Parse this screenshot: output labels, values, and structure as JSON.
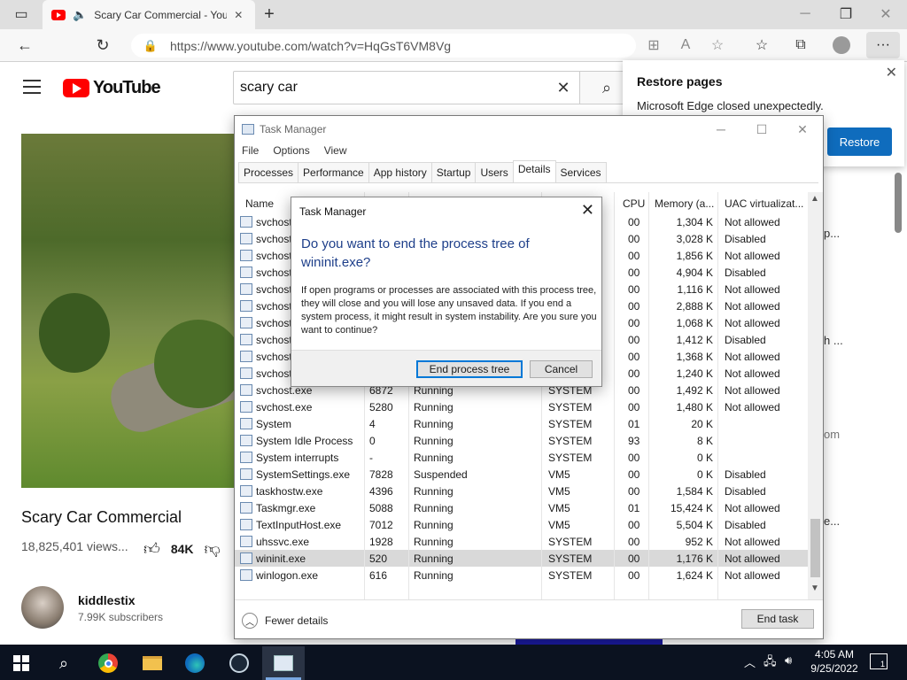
{
  "browser": {
    "tab_title": "Scary Car Commercial - You",
    "url": "https://www.youtube.com/watch?v=HqGsT6VM8Vg",
    "new_tab": "+",
    "window_controls": {
      "minimize": "─",
      "restore": "❐",
      "close": "✕"
    }
  },
  "youtube": {
    "logo_text": "YouTube",
    "search_value": "scary car",
    "video_title": "Scary Car Commercial",
    "views": "18,825,401 views...",
    "likes": "84K",
    "channel_name": "kiddlestix",
    "subscribers": "7.99K subscribers",
    "peek_texts": [
      "p...",
      "h ...",
      "om",
      "e..."
    ]
  },
  "restore_popup": {
    "title": "Restore pages",
    "message": "Microsoft Edge closed unexpectedly.",
    "button": "Restore"
  },
  "task_manager": {
    "title": "Task Manager",
    "menu": [
      "File",
      "Options",
      "View"
    ],
    "tabs": [
      "Processes",
      "Performance",
      "App history",
      "Startup",
      "Users",
      "Details",
      "Services"
    ],
    "active_tab": "Details",
    "columns": {
      "name": "Name",
      "cpu": "CPU",
      "memory": "Memory (a...",
      "uac": "UAC virtualizat..."
    },
    "rows": [
      {
        "name": "svchost.exe",
        "pid": "",
        "status": "",
        "user": "",
        "cpu": "00",
        "mem": "1,304 K",
        "uac": "Not allowed"
      },
      {
        "name": "svchost.exe",
        "pid": "",
        "status": "",
        "user": "",
        "cpu": "00",
        "mem": "3,028 K",
        "uac": "Disabled"
      },
      {
        "name": "svchost.exe",
        "pid": "",
        "status": "",
        "user": "",
        "cpu": "00",
        "mem": "1,856 K",
        "uac": "Not allowed"
      },
      {
        "name": "svchost.exe",
        "pid": "",
        "status": "",
        "user": "",
        "cpu": "00",
        "mem": "4,904 K",
        "uac": "Disabled"
      },
      {
        "name": "svchost.exe",
        "pid": "",
        "status": "",
        "user": "",
        "cpu": "00",
        "mem": "1,116 K",
        "uac": "Not allowed"
      },
      {
        "name": "svchost.exe",
        "pid": "",
        "status": "",
        "user": "",
        "cpu": "00",
        "mem": "2,888 K",
        "uac": "Not allowed"
      },
      {
        "name": "svchost.exe",
        "pid": "",
        "status": "",
        "user": "",
        "cpu": "00",
        "mem": "1,068 K",
        "uac": "Not allowed"
      },
      {
        "name": "svchost.exe",
        "pid": "",
        "status": "",
        "user": "",
        "cpu": "00",
        "mem": "1,412 K",
        "uac": "Disabled"
      },
      {
        "name": "svchost.exe",
        "pid": "",
        "status": "",
        "user": "",
        "cpu": "00",
        "mem": "1,368 K",
        "uac": "Not allowed"
      },
      {
        "name": "svchost.exe",
        "pid": "",
        "status": "",
        "user": "",
        "cpu": "00",
        "mem": "1,240 K",
        "uac": "Not allowed"
      },
      {
        "name": "svchost.exe",
        "pid": "6872",
        "status": "Running",
        "user": "SYSTEM",
        "cpu": "00",
        "mem": "1,492 K",
        "uac": "Not allowed"
      },
      {
        "name": "svchost.exe",
        "pid": "5280",
        "status": "Running",
        "user": "SYSTEM",
        "cpu": "00",
        "mem": "1,480 K",
        "uac": "Not allowed"
      },
      {
        "name": "System",
        "pid": "4",
        "status": "Running",
        "user": "SYSTEM",
        "cpu": "01",
        "mem": "20 K",
        "uac": ""
      },
      {
        "name": "System Idle Process",
        "pid": "0",
        "status": "Running",
        "user": "SYSTEM",
        "cpu": "93",
        "mem": "8 K",
        "uac": ""
      },
      {
        "name": "System interrupts",
        "pid": "-",
        "status": "Running",
        "user": "SYSTEM",
        "cpu": "00",
        "mem": "0 K",
        "uac": ""
      },
      {
        "name": "SystemSettings.exe",
        "pid": "7828",
        "status": "Suspended",
        "user": "VM5",
        "cpu": "00",
        "mem": "0 K",
        "uac": "Disabled"
      },
      {
        "name": "taskhostw.exe",
        "pid": "4396",
        "status": "Running",
        "user": "VM5",
        "cpu": "00",
        "mem": "1,584 K",
        "uac": "Disabled"
      },
      {
        "name": "Taskmgr.exe",
        "pid": "5088",
        "status": "Running",
        "user": "VM5",
        "cpu": "01",
        "mem": "15,424 K",
        "uac": "Not allowed"
      },
      {
        "name": "TextInputHost.exe",
        "pid": "7012",
        "status": "Running",
        "user": "VM5",
        "cpu": "00",
        "mem": "5,504 K",
        "uac": "Disabled"
      },
      {
        "name": "uhssvc.exe",
        "pid": "1928",
        "status": "Running",
        "user": "SYSTEM",
        "cpu": "00",
        "mem": "952 K",
        "uac": "Not allowed"
      },
      {
        "name": "wininit.exe",
        "pid": "520",
        "status": "Running",
        "user": "SYSTEM",
        "cpu": "00",
        "mem": "1,176 K",
        "uac": "Not allowed"
      },
      {
        "name": "winlogon.exe",
        "pid": "616",
        "status": "Running",
        "user": "SYSTEM",
        "cpu": "00",
        "mem": "1,624 K",
        "uac": "Not allowed"
      }
    ],
    "selected_row": "wininit.exe",
    "fewer_details": "Fewer details",
    "end_task": "End task"
  },
  "dialog": {
    "title": "Task Manager",
    "question": "Do you want to end the process tree of wininit.exe?",
    "body": "If open programs or processes are associated with this process tree, they will close and you will lose any unsaved data. If you end a system process, it might result in system instability. Are you sure you want to continue?",
    "confirm": "End process tree",
    "cancel": "Cancel"
  },
  "taskbar": {
    "time": "4:05 AM",
    "date": "9/25/2022",
    "notification_count": "1"
  }
}
